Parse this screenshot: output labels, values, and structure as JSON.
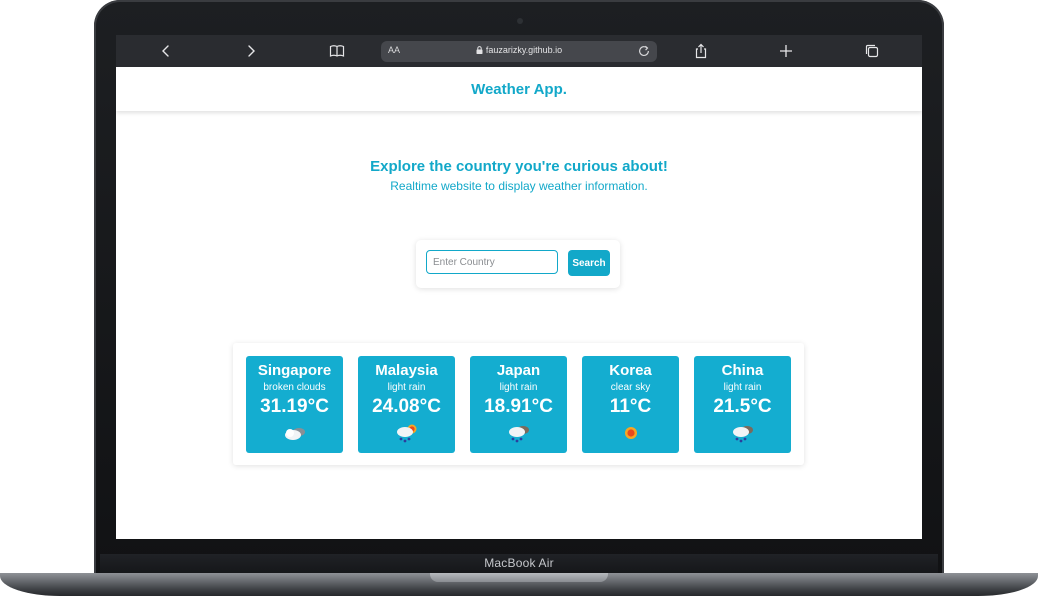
{
  "laptop": {
    "model_label": "MacBook Air"
  },
  "browser": {
    "text_size_label": "AA",
    "url": "fauzarizky.github.io"
  },
  "app": {
    "brand": "Weather App.",
    "hero_title": "Explore the country you're curious about!",
    "hero_subtitle": "Realtime website to display weather information.",
    "search": {
      "placeholder": "Enter Country",
      "value": "",
      "button_label": "Search"
    },
    "accent_color": "#12a8c9",
    "cities": [
      {
        "name": "Singapore",
        "condition": "broken clouds",
        "temp": "31.19°C",
        "icon": "broken-clouds-icon"
      },
      {
        "name": "Malaysia",
        "condition": "light rain",
        "temp": "24.08°C",
        "icon": "sun-rain-cloud-icon"
      },
      {
        "name": "Japan",
        "condition": "light rain",
        "temp": "18.91°C",
        "icon": "rain-cloud-icon"
      },
      {
        "name": "Korea",
        "condition": "clear sky",
        "temp": "11°C",
        "icon": "sun-icon"
      },
      {
        "name": "China",
        "condition": "light rain",
        "temp": "21.5°C",
        "icon": "rain-cloud-icon"
      }
    ]
  }
}
